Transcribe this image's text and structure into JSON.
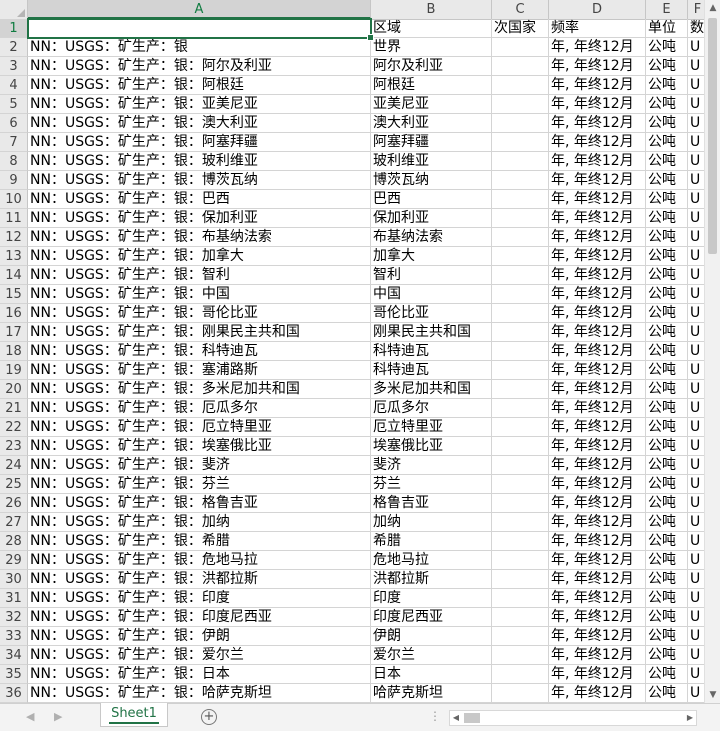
{
  "columns": [
    "A",
    "B",
    "C",
    "D",
    "E",
    "F"
  ],
  "selected_column": "A",
  "header_row": {
    "row": "1",
    "a": "",
    "b": "区域",
    "c": "次国家",
    "d": "频率",
    "e": "单位",
    "f": "数"
  },
  "rows": [
    {
      "row": "2",
      "a": "NN：USGS：矿生产：银",
      "b": "世界",
      "c": "",
      "d": "年, 年终12月",
      "e": "公吨",
      "f": "U"
    },
    {
      "row": "3",
      "a": "NN：USGS：矿生产：银：阿尔及利亚",
      "b": "阿尔及利亚",
      "c": "",
      "d": "年, 年终12月",
      "e": "公吨",
      "f": "U"
    },
    {
      "row": "4",
      "a": "NN：USGS：矿生产：银：阿根廷",
      "b": "阿根廷",
      "c": "",
      "d": "年, 年终12月",
      "e": "公吨",
      "f": "U"
    },
    {
      "row": "5",
      "a": "NN：USGS：矿生产：银：亚美尼亚",
      "b": "亚美尼亚",
      "c": "",
      "d": "年, 年终12月",
      "e": "公吨",
      "f": "U"
    },
    {
      "row": "6",
      "a": "NN：USGS：矿生产：银：澳大利亚",
      "b": "澳大利亚",
      "c": "",
      "d": "年, 年终12月",
      "e": "公吨",
      "f": "U"
    },
    {
      "row": "7",
      "a": "NN：USGS：矿生产：银：阿塞拜疆",
      "b": "阿塞拜疆",
      "c": "",
      "d": "年, 年终12月",
      "e": "公吨",
      "f": "U"
    },
    {
      "row": "8",
      "a": "NN：USGS：矿生产：银：玻利维亚",
      "b": "玻利维亚",
      "c": "",
      "d": "年, 年终12月",
      "e": "公吨",
      "f": "U"
    },
    {
      "row": "9",
      "a": "NN：USGS：矿生产：银：博茨瓦纳",
      "b": "博茨瓦纳",
      "c": "",
      "d": "年, 年终12月",
      "e": "公吨",
      "f": "U"
    },
    {
      "row": "10",
      "a": "NN：USGS：矿生产：银：巴西",
      "b": "巴西",
      "c": "",
      "d": "年, 年终12月",
      "e": "公吨",
      "f": "U"
    },
    {
      "row": "11",
      "a": "NN：USGS：矿生产：银：保加利亚",
      "b": "保加利亚",
      "c": "",
      "d": "年, 年终12月",
      "e": "公吨",
      "f": "U"
    },
    {
      "row": "12",
      "a": "NN：USGS：矿生产：银：布基纳法索",
      "b": "布基纳法索",
      "c": "",
      "d": "年, 年终12月",
      "e": "公吨",
      "f": "U"
    },
    {
      "row": "13",
      "a": "NN：USGS：矿生产：银：加拿大",
      "b": "加拿大",
      "c": "",
      "d": "年, 年终12月",
      "e": "公吨",
      "f": "U"
    },
    {
      "row": "14",
      "a": "NN：USGS：矿生产：银：智利",
      "b": "智利",
      "c": "",
      "d": "年, 年终12月",
      "e": "公吨",
      "f": "U"
    },
    {
      "row": "15",
      "a": "NN：USGS：矿生产：银：中国",
      "b": "中国",
      "c": "",
      "d": "年, 年终12月",
      "e": "公吨",
      "f": "U"
    },
    {
      "row": "16",
      "a": "NN：USGS：矿生产：银：哥伦比亚",
      "b": "哥伦比亚",
      "c": "",
      "d": "年, 年终12月",
      "e": "公吨",
      "f": "U"
    },
    {
      "row": "17",
      "a": "NN：USGS：矿生产：银：刚果民主共和国",
      "b": "刚果民主共和国",
      "c": "",
      "d": "年, 年终12月",
      "e": "公吨",
      "f": "U"
    },
    {
      "row": "18",
      "a": "NN：USGS：矿生产：银：科特迪瓦",
      "b": "科特迪瓦",
      "c": "",
      "d": "年, 年终12月",
      "e": "公吨",
      "f": "U"
    },
    {
      "row": "19",
      "a": "NN：USGS：矿生产：银：塞浦路斯",
      "b": "科特迪瓦",
      "c": "",
      "d": "年, 年终12月",
      "e": "公吨",
      "f": "U"
    },
    {
      "row": "20",
      "a": "NN：USGS：矿生产：银：多米尼加共和国",
      "b": "多米尼加共和国",
      "c": "",
      "d": "年, 年终12月",
      "e": "公吨",
      "f": "U"
    },
    {
      "row": "21",
      "a": "NN：USGS：矿生产：银：厄瓜多尔",
      "b": "厄瓜多尔",
      "c": "",
      "d": "年, 年终12月",
      "e": "公吨",
      "f": "U"
    },
    {
      "row": "22",
      "a": "NN：USGS：矿生产：银：厄立特里亚",
      "b": "厄立特里亚",
      "c": "",
      "d": "年, 年终12月",
      "e": "公吨",
      "f": "U"
    },
    {
      "row": "23",
      "a": "NN：USGS：矿生产：银：埃塞俄比亚",
      "b": "埃塞俄比亚",
      "c": "",
      "d": "年, 年终12月",
      "e": "公吨",
      "f": "U"
    },
    {
      "row": "24",
      "a": "NN：USGS：矿生产：银：斐济",
      "b": "斐济",
      "c": "",
      "d": "年, 年终12月",
      "e": "公吨",
      "f": "U"
    },
    {
      "row": "25",
      "a": "NN：USGS：矿生产：银：芬兰",
      "b": "芬兰",
      "c": "",
      "d": "年, 年终12月",
      "e": "公吨",
      "f": "U"
    },
    {
      "row": "26",
      "a": "NN：USGS：矿生产：银：格鲁吉亚",
      "b": "格鲁吉亚",
      "c": "",
      "d": "年, 年终12月",
      "e": "公吨",
      "f": "U"
    },
    {
      "row": "27",
      "a": "NN：USGS：矿生产：银：加纳",
      "b": "加纳",
      "c": "",
      "d": "年, 年终12月",
      "e": "公吨",
      "f": "U"
    },
    {
      "row": "28",
      "a": "NN：USGS：矿生产：银：希腊",
      "b": "希腊",
      "c": "",
      "d": "年, 年终12月",
      "e": "公吨",
      "f": "U"
    },
    {
      "row": "29",
      "a": "NN：USGS：矿生产：银：危地马拉",
      "b": "危地马拉",
      "c": "",
      "d": "年, 年终12月",
      "e": "公吨",
      "f": "U"
    },
    {
      "row": "30",
      "a": "NN：USGS：矿生产：银：洪都拉斯",
      "b": "洪都拉斯",
      "c": "",
      "d": "年, 年终12月",
      "e": "公吨",
      "f": "U"
    },
    {
      "row": "31",
      "a": "NN：USGS：矿生产：银：印度",
      "b": "印度",
      "c": "",
      "d": "年, 年终12月",
      "e": "公吨",
      "f": "U"
    },
    {
      "row": "32",
      "a": "NN：USGS：矿生产：银：印度尼西亚",
      "b": "印度尼西亚",
      "c": "",
      "d": "年, 年终12月",
      "e": "公吨",
      "f": "U"
    },
    {
      "row": "33",
      "a": "NN：USGS：矿生产：银：伊朗",
      "b": "伊朗",
      "c": "",
      "d": "年, 年终12月",
      "e": "公吨",
      "f": "U"
    },
    {
      "row": "34",
      "a": "NN：USGS：矿生产：银：爱尔兰",
      "b": "爱尔兰",
      "c": "",
      "d": "年, 年终12月",
      "e": "公吨",
      "f": "U"
    },
    {
      "row": "35",
      "a": "NN：USGS：矿生产：银：日本",
      "b": "日本",
      "c": "",
      "d": "年, 年终12月",
      "e": "公吨",
      "f": "U"
    },
    {
      "row": "36",
      "a": "NN：USGS：矿生产：银：哈萨克斯坦",
      "b": "哈萨克斯坦",
      "c": "",
      "d": "年, 年终12月",
      "e": "公吨",
      "f": "U"
    }
  ],
  "sheet_tab": "Sheet1",
  "add_sheet_symbol": "+",
  "icons": {
    "scroll_up": "chevron-up-icon",
    "scroll_down": "chevron-down-icon",
    "scroll_left": "chevron-left-icon",
    "scroll_right": "chevron-right-icon",
    "add_sheet": "plus-circle-icon",
    "more": "more-options-icon"
  },
  "colors": {
    "accent": "#217346",
    "header_bg": "#e9e9e9",
    "gridline": "#d4d4d4"
  }
}
